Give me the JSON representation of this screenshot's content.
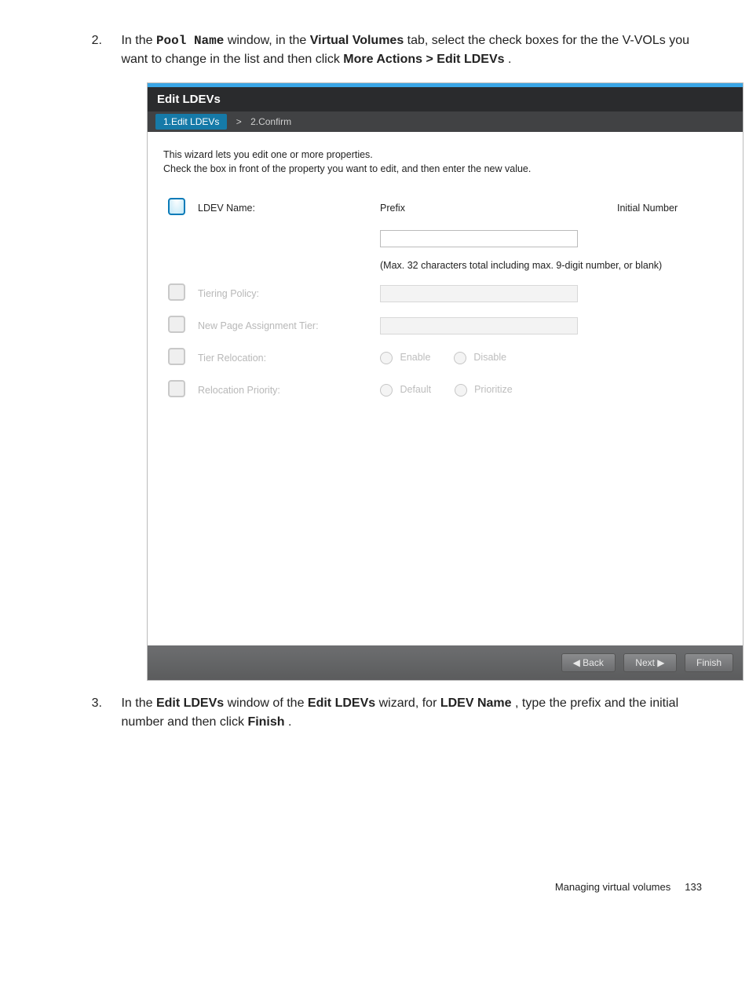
{
  "step2_text_a": "In the ",
  "step2_text_b": " window, in the ",
  "step2_text_c": " tab, select the check boxes for the the V-VOLs you want to change in the list and then click ",
  "step2_text_d": ".",
  "pool_name": "Pool Name",
  "vvtab": "Virtual Volumes",
  "more_edit": "More Actions > Edit LDEVs",
  "wizard": {
    "title": "Edit LDEVs",
    "step_cur": "1.Edit LDEVs",
    "step_other": "2.Confirm",
    "desc1": "This wizard lets you edit one or more properties.",
    "desc2": "Check the  box in front of the property you want to edit, and then enter the new value.",
    "rows": {
      "ldev_name": "LDEV Name:",
      "prefix": "Prefix",
      "initial": "Initial Number",
      "hint": "(Max. 32 characters total including max. 9-digit number, or blank)",
      "tiering": "Tiering Policy:",
      "newpage": "New Page Assignment Tier:",
      "tier_reloc": "Tier Relocation:",
      "enable": "Enable",
      "disable": "Disable",
      "reloc_prio": "Relocation Priority:",
      "default": "Default",
      "prioritize": "Prioritize"
    },
    "buttons": {
      "back": "◀ Back",
      "next": "Next ▶",
      "finish": "Finish"
    }
  },
  "step3_text_a": "In the ",
  "step3_text_b": " window of the ",
  "step3_text_c": " wizard, for ",
  "step3_text_d": ", type the prefix and the initial number and then click ",
  "step3_text_e": ".",
  "edit_ldevs_b": "Edit LDEVs",
  "ldev_name_b": "LDEV Name",
  "finish_b": "Finish",
  "footer_section": "Managing virtual volumes",
  "footer_page": "133"
}
